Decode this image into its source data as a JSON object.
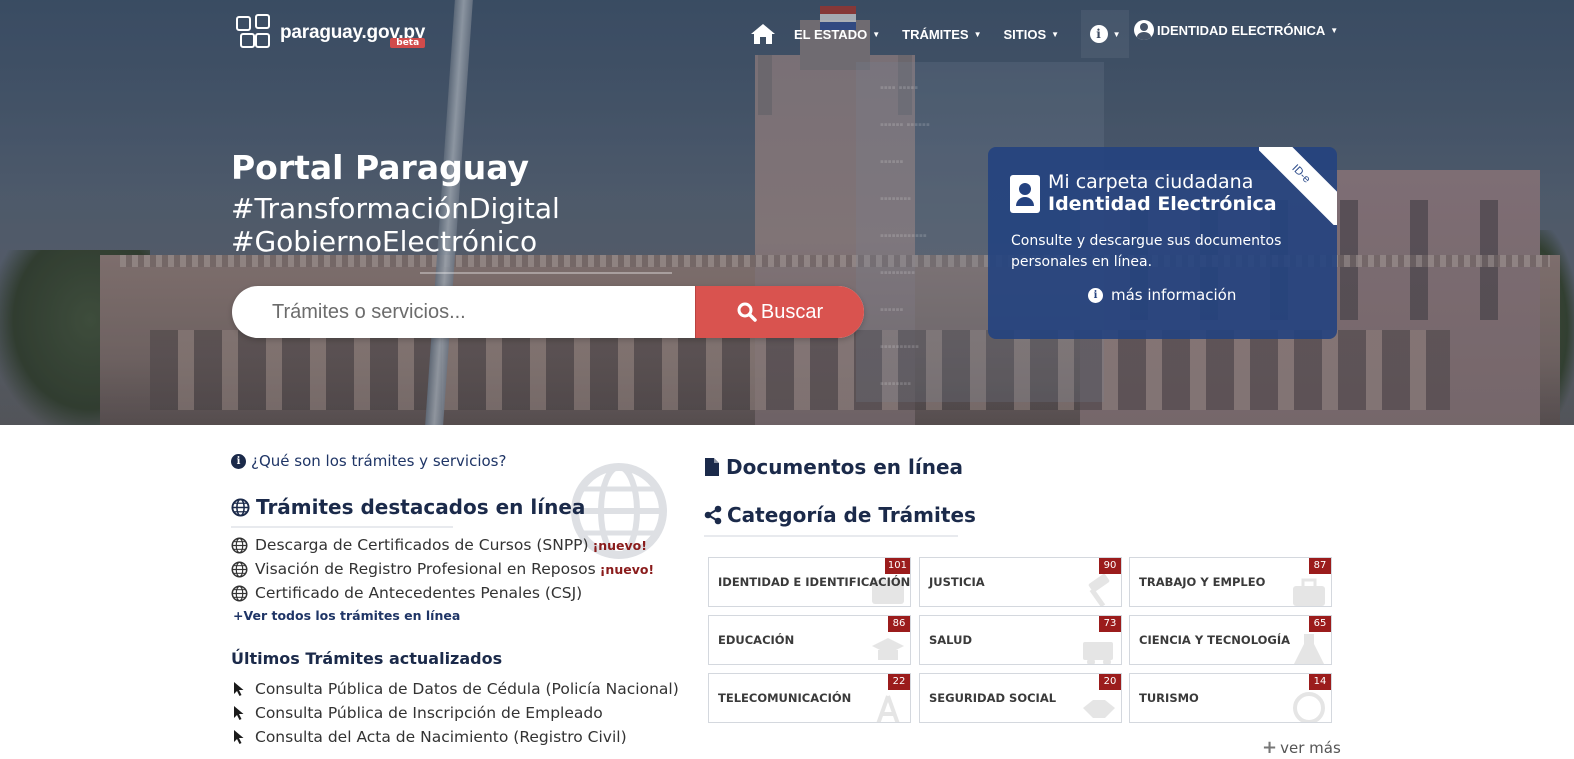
{
  "brand": {
    "name": "paraguay.gov.py",
    "badge": "beta"
  },
  "nav": {
    "items": [
      {
        "label": "EL ESTADO"
      },
      {
        "label": "TRÁMITES"
      },
      {
        "label": "SITIOS"
      }
    ],
    "identity": "IDENTIDAD ELECTRÓNICA"
  },
  "hero": {
    "title": "Portal Paraguay",
    "tag1": "#TransformaciónDigital",
    "tag2": "#GobiernoElectrónico"
  },
  "search": {
    "placeholder": "Trámites o servicios...",
    "button": "Buscar"
  },
  "idcard": {
    "line1": "Mi carpeta ciudadana",
    "line2": "Identidad Electrónica",
    "ribbon": "ID-e",
    "description": "Consulte y descargue sus documentos personales en línea.",
    "more": "más información"
  },
  "left": {
    "question": "¿Qué son los trámites y servicios?",
    "featured_title": "Trámites destacados en línea",
    "featured": [
      {
        "text": "Descarga de Certificados de Cursos (SNPP)",
        "badge": "¡nuevo!"
      },
      {
        "text": "Visación de Registro Profesional en Reposos",
        "badge": "¡nuevo!"
      },
      {
        "text": "Certificado de Antecedentes Penales (CSJ)",
        "badge": ""
      }
    ],
    "see_all": "Ver todos los trámites en línea",
    "updated_title": "Últimos Trámites actualizados",
    "updated": [
      "Consulta Pública de Datos de Cédula (Policía Nacional)",
      "Consulta Pública de Inscripción de Empleado",
      "Consulta del Acta de Nacimiento (Registro Civil)"
    ]
  },
  "right": {
    "documents_title": "Documentos en línea",
    "categories_title": "Categoría de Trámites",
    "categories": [
      {
        "label": "IDENTIDAD E IDENTIFICACIÓN",
        "count": "101"
      },
      {
        "label": "JUSTICIA",
        "count": "90"
      },
      {
        "label": "TRABAJO Y EMPLEO",
        "count": "87"
      },
      {
        "label": "EDUCACIÓN",
        "count": "86"
      },
      {
        "label": "SALUD",
        "count": "73"
      },
      {
        "label": "CIENCIA Y TECNOLOGÍA",
        "count": "65"
      },
      {
        "label": "TELECOMUNICACIÓN",
        "count": "22"
      },
      {
        "label": "SEGURIDAD SOCIAL",
        "count": "20"
      },
      {
        "label": "TURISMO",
        "count": "14"
      }
    ],
    "see_more": "ver más"
  },
  "colors": {
    "primary_navy": "#1b2a4a",
    "search_red": "#d9534f",
    "badge_red": "#9b1c1c",
    "card_blue": "#244280"
  },
  "icons": [
    "home-icon",
    "info-icon",
    "user-icon",
    "search-icon",
    "globe-icon",
    "cursor-icon",
    "file-icon",
    "share-icon",
    "id-card-icon"
  ]
}
